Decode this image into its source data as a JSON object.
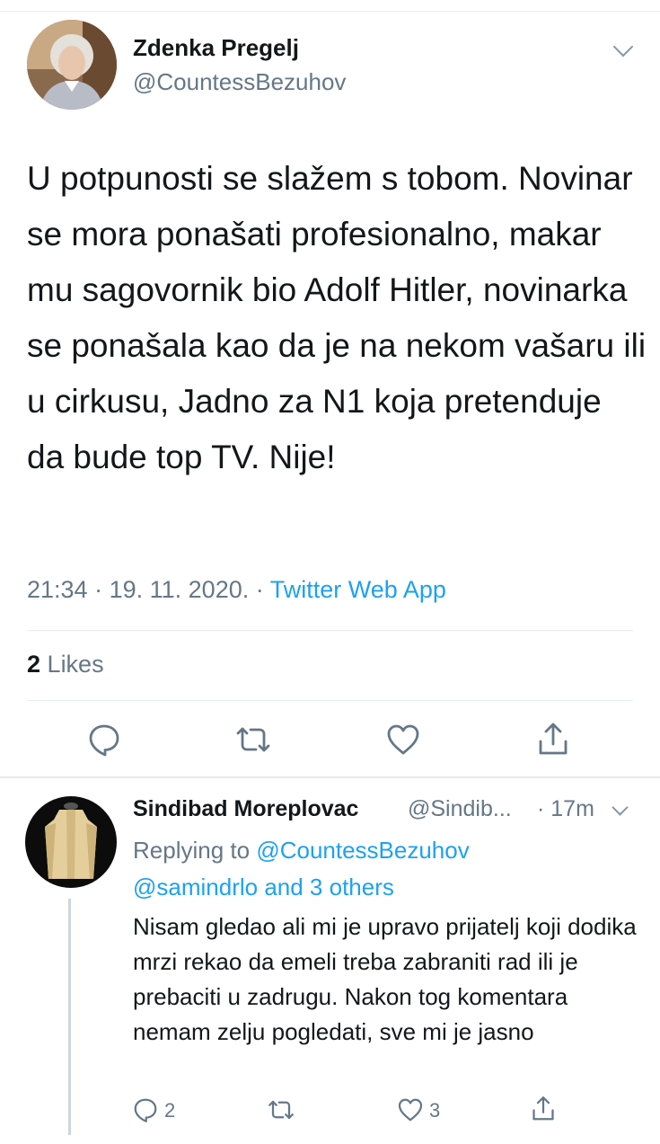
{
  "tweet": {
    "author_name": "Zdenka Pregelj",
    "author_handle": "@CountessBezuhov",
    "text": "U potpunosti se slažem s tobom. Novinar se mora ponašati profesionalno, makar mu sagovornik bio Adolf Hitler, novinarka se ponašala kao da je na nekom vašaru ili u cirkusu, Jadno za N1 koja pretenduje da bude top TV. Nije!",
    "time": "21:34",
    "date": "19. 11. 2020.",
    "source": "Twitter Web App",
    "likes_count": "2",
    "likes_label": "Likes",
    "actions": [
      "reply-icon",
      "retweet-icon",
      "like-icon",
      "share-icon"
    ]
  },
  "reply": {
    "author_name": "Sindibad Moreplovac",
    "author_handle": "@Sindib...",
    "time": "17m",
    "replying_prefix": "Replying to",
    "replying_to": "@CountessBezuhov",
    "replying_others": "@samindrlo and 3 others",
    "text": "Nisam gledao ali mi je upravo prijatelj koji dodika mrzi rekao da emeli treba zabraniti rad ili je prebaciti u zadrugu. Nakon tog komentara nemam zelju pogledati, sve mi je jasno",
    "reply_count": "2",
    "like_count": "3"
  },
  "colors": {
    "link": "#1da1f2",
    "secondary_text": "#657786",
    "primary_text": "#14171a",
    "divider": "#e6ecf0"
  }
}
